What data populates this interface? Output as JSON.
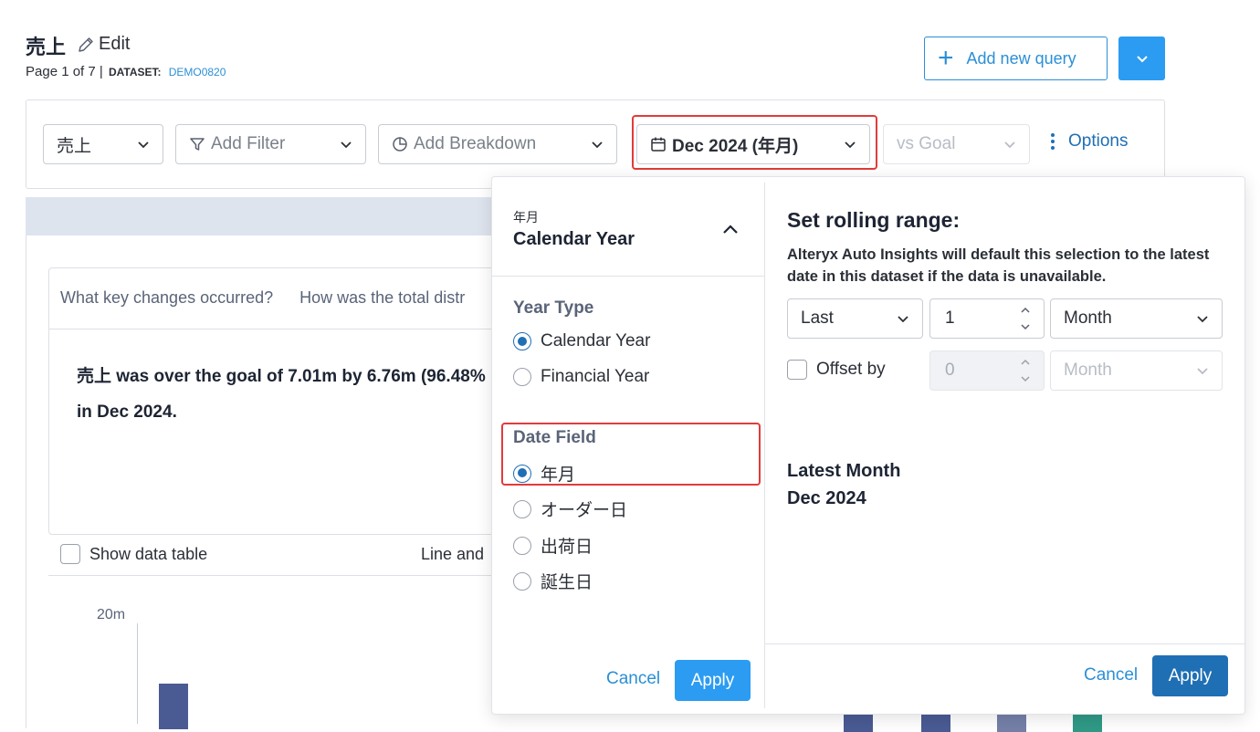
{
  "header": {
    "title": "売上",
    "edit_label": "Edit",
    "page_info": "Page 1 of 7 |",
    "dataset_label": "DATASET:",
    "dataset_name": "DEMO0820",
    "add_query_label": "Add new query"
  },
  "filter_bar": {
    "measure": "売上",
    "add_filter": "Add Filter",
    "add_breakdown": "Add Breakdown",
    "date": "Dec 2024 (年月)",
    "vs_goal": "vs Goal",
    "options": "Options"
  },
  "background": {
    "questions": [
      "What key changes occurred?",
      "How was the total distr"
    ],
    "summary_line1": "売上 was over the goal of 7.01m by 6.76m (96.48%",
    "summary_line2": "in Dec 2024.",
    "show_data_table": "Show data table",
    "chart_type": "Line and",
    "y_tick": "20m",
    "bar_colors": [
      "#4a5b94",
      "#4a5b94",
      "#7580a8",
      "#2f9a86"
    ]
  },
  "popover": {
    "calendar_small": "年月",
    "calendar_big": "Calendar Year",
    "year_type_heading": "Year Type",
    "year_types": [
      {
        "label": "Calendar Year",
        "selected": true
      },
      {
        "label": "Financial Year",
        "selected": false
      }
    ],
    "date_field_heading": "Date Field",
    "date_fields": [
      {
        "label": "年月",
        "selected": true
      },
      {
        "label": "オーダー日",
        "selected": false
      },
      {
        "label": "出荷日",
        "selected": false
      },
      {
        "label": "誕生日",
        "selected": false
      }
    ],
    "cancel_left": "Cancel",
    "apply_left": "Apply",
    "rolling_title": "Set rolling range:",
    "rolling_desc": "Alteryx Auto Insights will default this selection to the latest date in this dataset if the data is unavailable.",
    "range_mode": "Last",
    "range_count": "1",
    "range_unit": "Month",
    "offset_label": "Offset by",
    "offset_count": "0",
    "offset_unit": "Month",
    "latest_label": "Latest Month",
    "latest_value": "Dec 2024",
    "cancel_right": "Cancel",
    "apply_right": "Apply"
  }
}
